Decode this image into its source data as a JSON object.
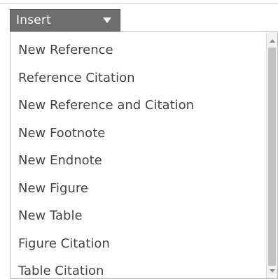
{
  "insert_button": {
    "label": "Insert",
    "caret_icon": "caret-down-icon"
  },
  "menu": {
    "items": [
      {
        "label": "New Reference"
      },
      {
        "label": "Reference Citation"
      },
      {
        "label": "New Reference and Citation"
      },
      {
        "label": "New Footnote"
      },
      {
        "label": "New Endnote"
      },
      {
        "label": "New Figure"
      },
      {
        "label": "New Table"
      },
      {
        "label": "Figure Citation"
      },
      {
        "label": "Table Citation"
      }
    ]
  },
  "scrollbar": {
    "up_icon": "scroll-up-arrow-icon",
    "down_icon": "scroll-down-arrow-icon"
  },
  "colors": {
    "button_bg": "#6f6f6f",
    "button_text": "#ffffff",
    "menu_text": "#444444",
    "scroll_thumb": "#c1c1c1"
  }
}
